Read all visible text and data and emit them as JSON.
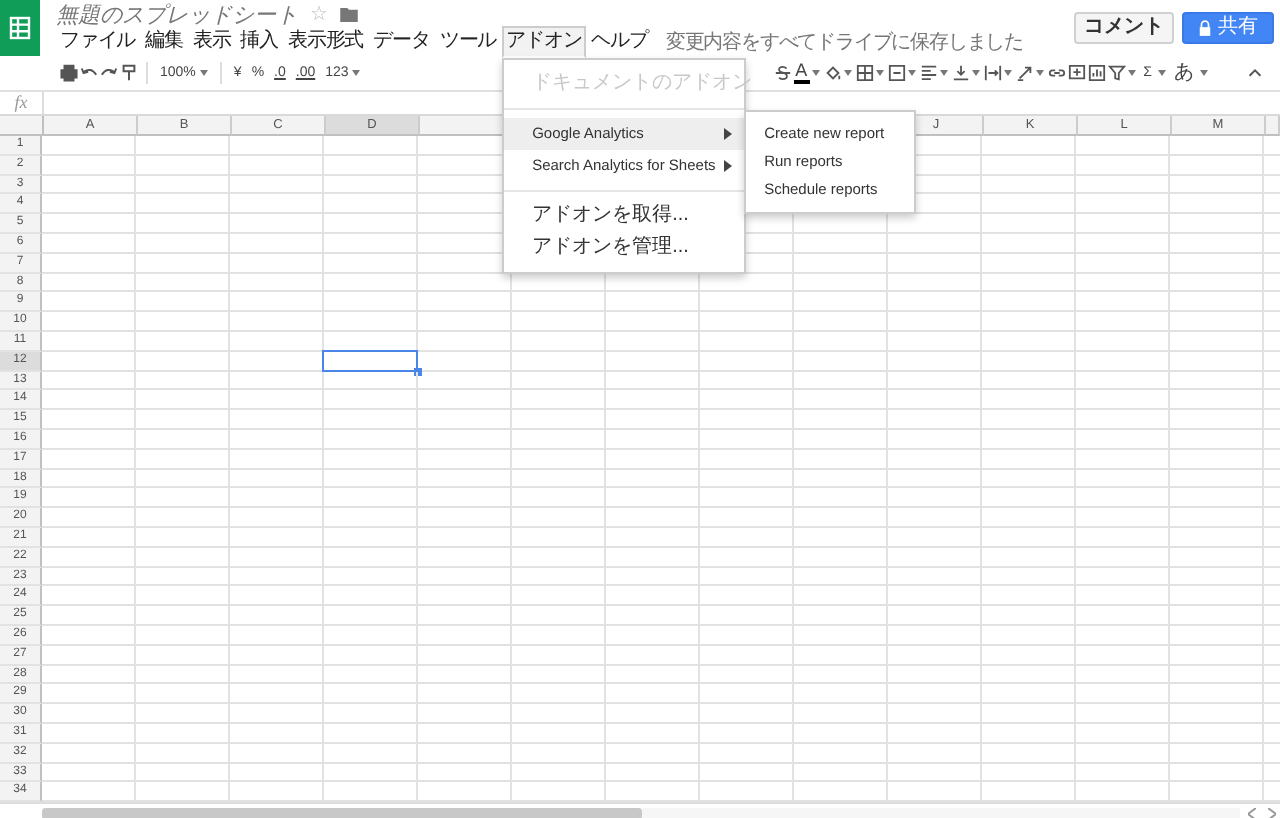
{
  "app": {
    "title": "無題のスプレッドシート",
    "star": "☆"
  },
  "menu_bar": [
    {
      "label": "ファイル",
      "selected": false
    },
    {
      "label": "編集",
      "selected": false
    },
    {
      "label": "表示",
      "selected": false
    },
    {
      "label": "挿入",
      "selected": false
    },
    {
      "label": "表示形式",
      "selected": false
    },
    {
      "label": "データ",
      "selected": false
    },
    {
      "label": "ツール",
      "selected": false
    },
    {
      "label": "アドオン",
      "selected": true
    },
    {
      "label": "ヘルプ",
      "selected": false
    }
  ],
  "save_status": "変更内容をすべてドライブに保存しました",
  "buttons": [
    {
      "label": "コメント",
      "kind": "plain"
    },
    {
      "label": "共有",
      "kind": "primary"
    }
  ],
  "toolbar": {
    "zoom": "100%",
    "currency": "¥",
    "percent": "%",
    "decimal_less": ".0",
    "decimal_more": ".00",
    "number_format": "123",
    "text_color": "A",
    "functions": "Σ",
    "input_tools": "あ"
  },
  "formula_bar": {
    "label": "fx"
  },
  "addon_menu": {
    "items": [
      {
        "kind": "item",
        "label": "ドキュメントのアドオン",
        "disabled": true,
        "selected": false
      },
      {
        "kind": "divider"
      },
      {
        "kind": "submenu",
        "label": "Google Analytics",
        "disabled": false,
        "selected": true
      },
      {
        "kind": "submenu",
        "label": "Search Analytics for Sheets",
        "disabled": false,
        "selected": false
      },
      {
        "kind": "divider"
      },
      {
        "kind": "item",
        "label": "アドオンを取得...",
        "disabled": false,
        "selected": false
      },
      {
        "kind": "item",
        "label": "アドオンを管理...",
        "disabled": false,
        "selected": false
      }
    ],
    "submenu": [
      {
        "label": "Create new report",
        "selected": false
      },
      {
        "label": "Run reports",
        "selected": false
      },
      {
        "label": "Schedule reports",
        "selected": false
      }
    ]
  },
  "columns": [
    {
      "label": "A",
      "selected": false
    },
    {
      "label": "B",
      "selected": false
    },
    {
      "label": "C",
      "selected": false
    },
    {
      "label": "D",
      "selected": true
    },
    {
      "selected": false
    },
    {},
    {},
    {},
    {},
    {
      "label": "J",
      "selected": false
    },
    {
      "label": "K",
      "selected": false
    },
    {
      "label": "L",
      "selected": false
    },
    {
      "label": "M",
      "selected": false
    }
  ],
  "rows": [
    {
      "label": "1",
      "selected": false
    },
    {
      "label": "2",
      "selected": false
    },
    {
      "label": "3",
      "selected": false
    },
    {
      "label": "4",
      "selected": false
    },
    {
      "label": "5",
      "selected": false
    },
    {
      "label": "6",
      "selected": false
    },
    {
      "label": "7",
      "selected": false
    },
    {
      "label": "8",
      "selected": false
    },
    {
      "label": "9",
      "selected": false
    },
    {
      "label": "10",
      "selected": false
    },
    {
      "label": "11",
      "selected": false
    },
    {
      "label": "12",
      "selected": true
    },
    {
      "label": "13",
      "selected": false
    },
    {
      "label": "14",
      "selected": false
    },
    {
      "label": "15",
      "selected": false
    },
    {
      "label": "16",
      "selected": false
    },
    {
      "label": "17",
      "selected": false
    },
    {
      "label": "18",
      "selected": false
    },
    {
      "label": "19",
      "selected": false
    },
    {
      "label": "20",
      "selected": false
    },
    {
      "label": "21",
      "selected": false
    },
    {
      "label": "22",
      "selected": false
    },
    {
      "label": "23",
      "selected": false
    },
    {
      "label": "24",
      "selected": false
    },
    {
      "label": "25",
      "selected": false
    },
    {
      "label": "26",
      "selected": false
    },
    {
      "label": "27",
      "selected": false
    },
    {
      "label": "28",
      "selected": false
    },
    {
      "label": "29",
      "selected": false
    },
    {
      "label": "30",
      "selected": false
    },
    {
      "label": "31",
      "selected": false
    },
    {
      "label": "32",
      "selected": false
    },
    {
      "label": "33",
      "selected": false
    },
    {
      "label": "34",
      "selected": false
    }
  ]
}
